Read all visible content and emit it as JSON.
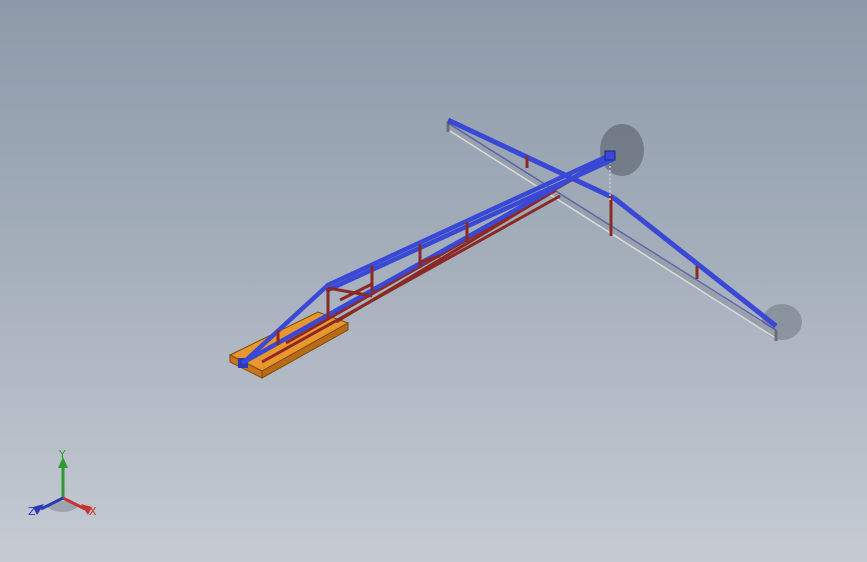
{
  "viewport": {
    "background_top": "#8d9aa9",
    "background_bottom": "#c6cbd3"
  },
  "model": {
    "colors": {
      "blue_beam": "#3a48d6",
      "red_member": "#8b2a24",
      "orange_base": "#e8962e",
      "grey_rail": "#9aa0a8",
      "shadow": "#2a2f36"
    }
  },
  "triad": {
    "y_label": "Y",
    "x_label": "X",
    "z_label": "Z",
    "y_color": "#2f9a2f",
    "x_color": "#c83232",
    "z_color": "#2a39b8"
  }
}
